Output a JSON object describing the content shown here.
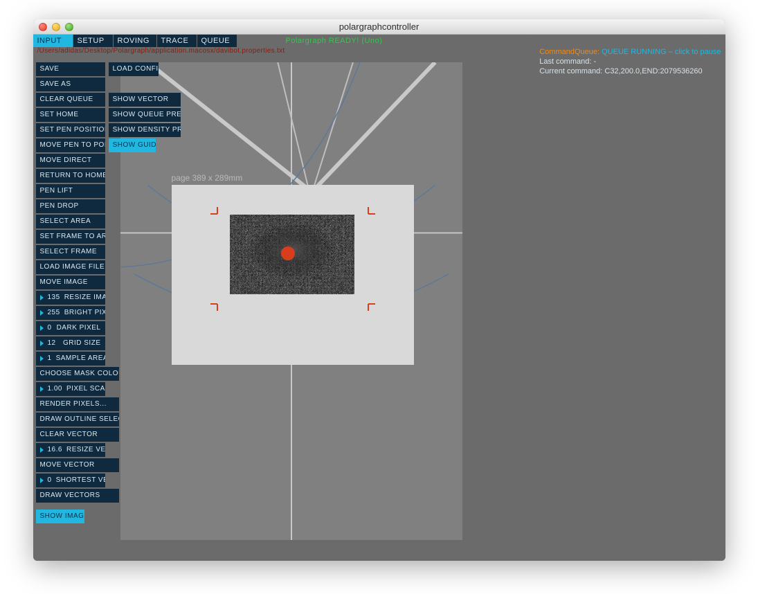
{
  "window": {
    "title": "polargraphcontroller"
  },
  "tabs": [
    {
      "label": "INPUT",
      "active": true
    },
    {
      "label": "SETUP",
      "active": false
    },
    {
      "label": "ROVING",
      "active": false
    },
    {
      "label": "TRACE",
      "active": false
    },
    {
      "label": "QUEUE",
      "active": false
    }
  ],
  "status_ready": "Polargraph READY! (Uno)",
  "config_path": "/Users/adidas/Desktop/Polargraph/application.macosx/davibot.properties.txt",
  "queue": {
    "label": "CommandQueue:",
    "state": "QUEUE RUNNING – click to pause",
    "last_command_label": "Last command:",
    "last_command": "-",
    "current_command_label": "Current command:",
    "current_command": "C32,200.0,END:2079536260"
  },
  "col1": [
    {
      "label": "SAVE"
    },
    {
      "label": "SAVE AS"
    },
    {
      "label": "CLEAR QUEUE"
    },
    {
      "label": "SET HOME"
    },
    {
      "label": "SET PEN POSITION"
    },
    {
      "label": "MOVE PEN TO POINT"
    },
    {
      "label": "MOVE DIRECT"
    },
    {
      "label": "RETURN TO HOME"
    },
    {
      "label": "PEN LIFT"
    },
    {
      "label": "PEN DROP"
    },
    {
      "label": "SELECT AREA"
    },
    {
      "label": "SET FRAME TO AREA"
    },
    {
      "label": "SELECT FRAME"
    },
    {
      "label": "LOAD IMAGE FILE"
    },
    {
      "label": "MOVE IMAGE"
    }
  ],
  "numbersA": [
    {
      "val": "135",
      "lab": "RESIZE IMAGE"
    },
    {
      "val": "255",
      "lab": "BRIGHT PIXEL"
    },
    {
      "val": "0",
      "lab": "DARK PIXEL"
    },
    {
      "val": "12",
      "lab": "GRID SIZE"
    },
    {
      "val": "1",
      "lab": "SAMPLE AREA"
    }
  ],
  "midbtns": [
    {
      "label": "CHOOSE MASK COLOUR"
    }
  ],
  "numbersB": [
    {
      "val": "1.00",
      "lab": "PIXEL SCALING"
    }
  ],
  "midbtns2": [
    {
      "label": "RENDER PIXELS..."
    },
    {
      "label": "DRAW OUTLINE SELECTED"
    },
    {
      "label": "CLEAR VECTOR"
    }
  ],
  "numbersC": [
    {
      "val": "16.6",
      "lab": "RESIZE VECTOR"
    }
  ],
  "midbtns3": [
    {
      "label": "MOVE VECTOR"
    }
  ],
  "numbersD": [
    {
      "val": "0",
      "lab": "SHORTEST VECTOR"
    }
  ],
  "endbtns": [
    {
      "label": "DRAW VECTORS"
    },
    {
      "label": "SHOW IMAGE",
      "on": true
    }
  ],
  "col2": [
    {
      "label": "LOAD CONFIG"
    },
    {
      "label": ""
    },
    {
      "label": "SHOW VECTOR"
    },
    {
      "label": "SHOW QUEUE PREVIEW"
    },
    {
      "label": "SHOW DENSITY PREVIEW"
    },
    {
      "label": "SHOW GUIDES",
      "on": true
    }
  ],
  "page_label": "page 389 x 289mm"
}
